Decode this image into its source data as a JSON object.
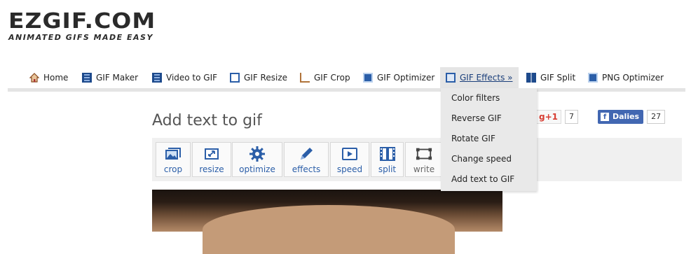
{
  "logo": {
    "main": "EZGIF.COM",
    "tagline": "ANIMATED GIFS MADE EASY"
  },
  "nav": {
    "items": [
      {
        "label": "Home",
        "icon": "home-icon"
      },
      {
        "label": "GIF Maker",
        "icon": "film-icon"
      },
      {
        "label": "Video to GIF",
        "icon": "film-icon"
      },
      {
        "label": "GIF Resize",
        "icon": "resize-icon"
      },
      {
        "label": "GIF Crop",
        "icon": "crop-icon"
      },
      {
        "label": "GIF Optimizer",
        "icon": "optimizer-icon"
      },
      {
        "label": "GIF Effects »",
        "icon": "effects-icon",
        "active": true
      },
      {
        "label": "GIF Split",
        "icon": "split-icon"
      },
      {
        "label": "PNG Optimizer",
        "icon": "optimizer-icon"
      }
    ]
  },
  "dropdown": {
    "items": [
      "Color filters",
      "Reverse GIF",
      "Rotate GIF",
      "Change speed",
      "Add text to GIF"
    ]
  },
  "page": {
    "title": "Add text to gif"
  },
  "social": {
    "gplus_label": "g+1",
    "gplus_count": "7",
    "fb_label": "Dalies",
    "fb_count": "27"
  },
  "toolbar": {
    "tools": [
      {
        "label": "crop",
        "icon": "crop-image-icon"
      },
      {
        "label": "resize",
        "icon": "resize-icon"
      },
      {
        "label": "optimize",
        "icon": "gear-icon"
      },
      {
        "label": "effects",
        "icon": "pencil-icon"
      },
      {
        "label": "speed",
        "icon": "play-icon"
      },
      {
        "label": "split",
        "icon": "film-strip-icon"
      },
      {
        "label": "write",
        "icon": "text-frame-icon"
      }
    ]
  },
  "colors": {
    "accent": "#2b5ea8",
    "nav_active_bg": "#e5e5e5",
    "fb_blue": "#4267b2",
    "gplus_red": "#d73d32"
  }
}
